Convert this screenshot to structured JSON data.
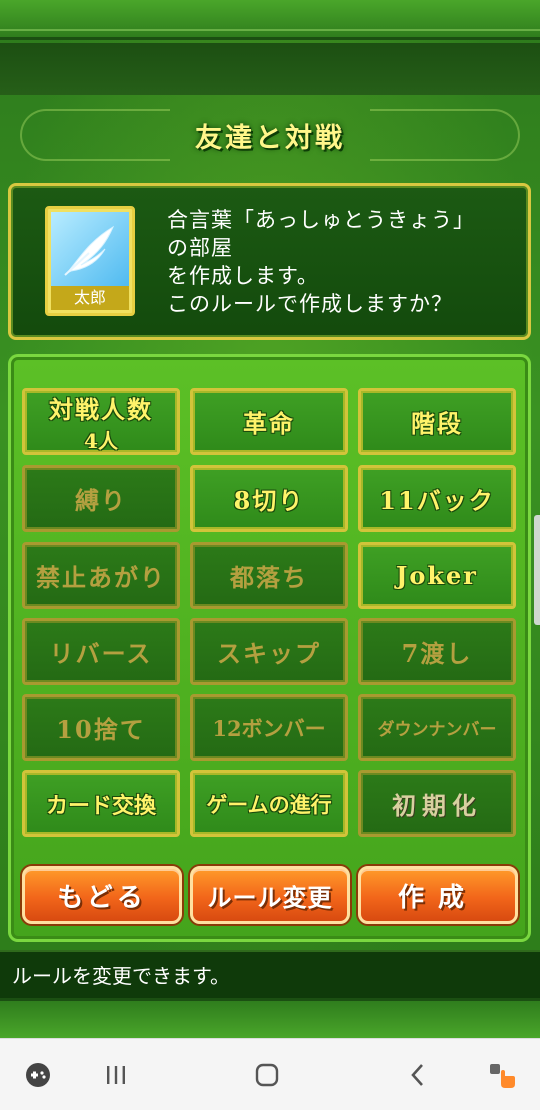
{
  "header": {
    "title": "友達と対戦"
  },
  "room": {
    "avatar_name": "太郎",
    "lines": [
      "合言葉「あっしゅとうきょう」",
      "の部屋",
      "を作成します。",
      "このルールで作成しますか？"
    ]
  },
  "rules": {
    "players": {
      "label": "対戦人数",
      "value": "4人",
      "enabled": true
    },
    "revolution": {
      "label": "革命",
      "enabled": true
    },
    "stairs": {
      "label": "階段",
      "enabled": true
    },
    "bind": {
      "label": "縛り",
      "enabled": false
    },
    "eight_cut": {
      "label": "8切り",
      "enabled": true
    },
    "eleven_back": {
      "label": "11バック",
      "enabled": true
    },
    "forbidden_finish": {
      "label": "禁止あがり",
      "enabled": false
    },
    "capital_fall": {
      "label": "都落ち",
      "enabled": false
    },
    "joker": {
      "label": "Joker",
      "enabled": true
    },
    "reverse": {
      "label": "リバース",
      "enabled": false
    },
    "skip": {
      "label": "スキップ",
      "enabled": false
    },
    "seven_pass": {
      "label": "7渡し",
      "enabled": false
    },
    "ten_discard": {
      "label": "10捨て",
      "enabled": false
    },
    "twelve_bomber": {
      "label": "12ボンバー",
      "enabled": false
    },
    "down_number": {
      "label": "ダウンナンバー",
      "enabled": false
    },
    "card_exchange": {
      "label": "カード交換",
      "enabled": true
    },
    "game_progress": {
      "label": "ゲームの進行",
      "enabled": true
    },
    "reset": {
      "label": "初期化"
    }
  },
  "actions": {
    "back": "もどる",
    "change_rules": "ルール変更",
    "create": "作成"
  },
  "message": "ルールを変更できます。",
  "colors": {
    "gold_text": "#fff36a",
    "disabled_text": "#b4a040",
    "action_orange": "#f2661a",
    "panel_green": "#44a41c"
  },
  "nav": {
    "icons": [
      "gamepad-icon",
      "recent-apps-icon",
      "home-icon",
      "back-icon",
      "accessibility-icon"
    ]
  }
}
